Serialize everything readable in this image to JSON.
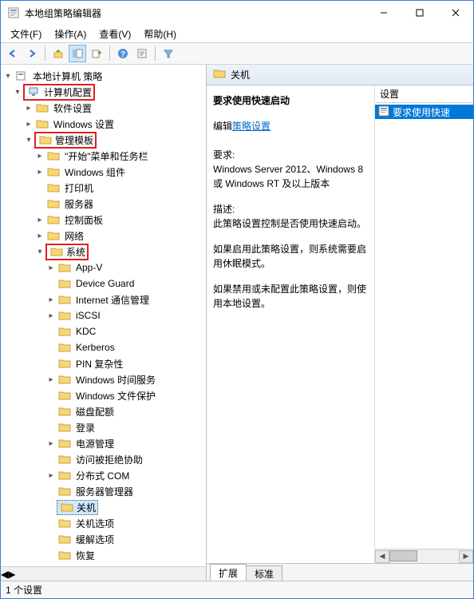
{
  "window": {
    "title": "本地组策略编辑器"
  },
  "menubar": {
    "file": "文件(F)",
    "action": "操作(A)",
    "view": "查看(V)",
    "help": "帮助(H)"
  },
  "tree": {
    "root": "本地计算机 策略",
    "computer_config": "计算机配置",
    "software_settings": "软件设置",
    "windows_settings": "Windows 设置",
    "admin_templates": "管理模板",
    "start_taskbar": "\"开始\"菜单和任务栏",
    "windows_components": "Windows 组件",
    "printers": "打印机",
    "servers": "服务器",
    "control_panel": "控制面板",
    "network": "网络",
    "system": "系统",
    "appv": "App-V",
    "device_guard": "Device Guard",
    "internet_mgmt": "Internet 通信管理",
    "iscsi": "iSCSI",
    "kdc": "KDC",
    "kerberos": "Kerberos",
    "pin": "PIN 复杂性",
    "time_service": "Windows 时间服务",
    "file_protection": "Windows 文件保护",
    "disk_quota": "磁盘配额",
    "login": "登录",
    "power_mgmt": "电源管理",
    "access_denied": "访问被拒绝协助",
    "dcom": "分布式 COM",
    "server_mgr": "服务器管理器",
    "shutdown": "关机",
    "shutdown_options": "关机选项",
    "mitigation": "缓解选项",
    "recovery": "恢复"
  },
  "right": {
    "header": "关机",
    "title": "要求使用快速启动",
    "edit_prefix": "编辑",
    "edit_link": "策略设置",
    "req_label": "要求:",
    "req_text": "Windows Server 2012、Windows 8 或 Windows RT 及以上版本",
    "desc_label": "描述:",
    "desc_text": "此策略设置控制是否使用快速启动。",
    "para2": "如果启用此策略设置，则系统需要启用休眠模式。",
    "para3": "如果禁用或未配置此策略设置，则使用本地设置。",
    "list_header": "设置",
    "list_item": "要求使用快速",
    "tab_ext": "扩展",
    "tab_std": "标准"
  },
  "status": {
    "text": "1 个设置"
  }
}
